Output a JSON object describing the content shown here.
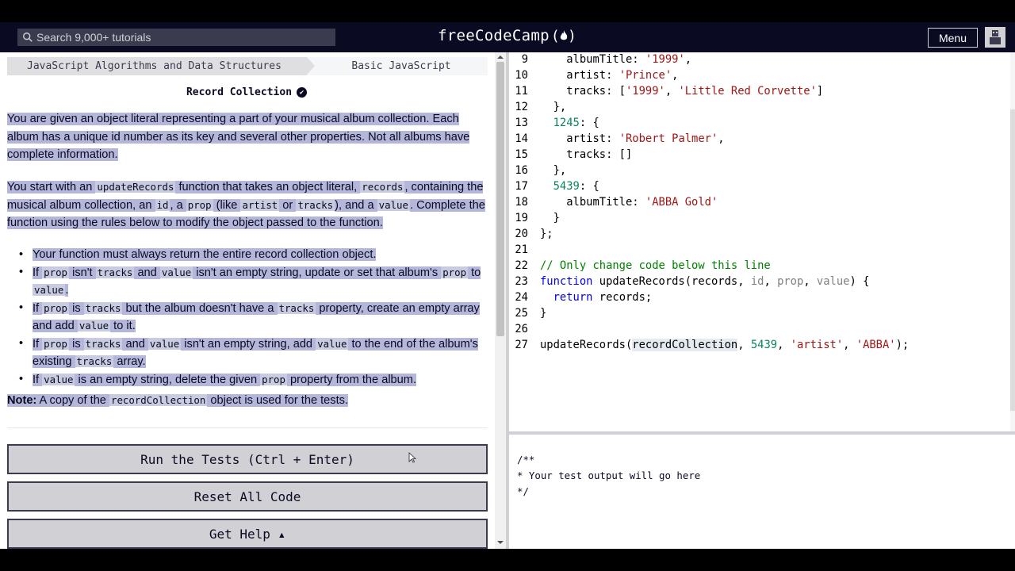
{
  "navbar": {
    "search_placeholder": "Search 9,000+ tutorials",
    "brand": "freeCodeCamp",
    "brand_icon": "(🔥)",
    "menu_label": "Menu"
  },
  "breadcrumb": {
    "superblock": "JavaScript Algorithms and Data Structures",
    "block": "Basic JavaScript"
  },
  "challenge": {
    "title": "Record Collection",
    "check_glyph": "✔"
  },
  "description": {
    "p1": "You are given an object literal representing a part of your musical album collection. Each album has a unique id number as its key and several other properties. Not all albums have complete information.",
    "p2": [
      "You start with an ",
      "updateRecords",
      " function that takes an object literal, ",
      "records",
      ", containing the musical album collection, an ",
      "id",
      ", a ",
      "prop",
      " (like ",
      "artist",
      " or ",
      "tracks",
      "), and a ",
      "value",
      ". Complete the function using the rules below to modify the object passed to the function."
    ],
    "rules": [
      [
        "Your function must always return the entire record collection object."
      ],
      [
        "If ",
        "prop",
        " isn't ",
        "tracks",
        " and ",
        "value",
        " isn't an empty string, update or set that album's ",
        "prop",
        " to ",
        "value",
        "."
      ],
      [
        "If ",
        "prop",
        " is ",
        "tracks",
        " but the album doesn't have a ",
        "tracks",
        " property, create an empty array and add ",
        "value",
        " to it."
      ],
      [
        "If ",
        "prop",
        " is ",
        "tracks",
        " and ",
        "value",
        " isn't an empty string, add ",
        "value",
        " to the end of the album's existing ",
        "tracks",
        " array."
      ],
      [
        "If ",
        "value",
        " is an empty string, delete the given ",
        "prop",
        " property from the album."
      ]
    ],
    "note_label": "Note:",
    "note": [
      " A copy of the ",
      "recordCollection",
      " object is used for the tests."
    ]
  },
  "buttons": {
    "run": "Run the Tests (Ctrl + Enter)",
    "reset": "Reset All Code",
    "help": "Get Help ▴"
  },
  "editor": {
    "lines": [
      {
        "n": "9",
        "t": [
          [
            "    albumTitle: ",
            ""
          ],
          [
            "'1999'",
            "str"
          ],
          [
            ",",
            ""
          ]
        ]
      },
      {
        "n": "10",
        "t": [
          [
            "    artist: ",
            ""
          ],
          [
            "'Prince'",
            "str"
          ],
          [
            ",",
            ""
          ]
        ]
      },
      {
        "n": "11",
        "t": [
          [
            "    tracks: [",
            ""
          ],
          [
            "'1999'",
            "str"
          ],
          [
            ", ",
            ""
          ],
          [
            "'Little Red Corvette'",
            "str"
          ],
          [
            "]",
            ""
          ]
        ]
      },
      {
        "n": "12",
        "t": [
          [
            "  },",
            ""
          ]
        ]
      },
      {
        "n": "13",
        "t": [
          [
            "  ",
            ""
          ],
          [
            "1245",
            "num"
          ],
          [
            ": {",
            ""
          ]
        ]
      },
      {
        "n": "14",
        "t": [
          [
            "    artist: ",
            ""
          ],
          [
            "'Robert Palmer'",
            "str"
          ],
          [
            ",",
            ""
          ]
        ]
      },
      {
        "n": "15",
        "t": [
          [
            "    tracks: []",
            ""
          ]
        ]
      },
      {
        "n": "16",
        "t": [
          [
            "  },",
            ""
          ]
        ]
      },
      {
        "n": "17",
        "t": [
          [
            "  ",
            ""
          ],
          [
            "5439",
            "num"
          ],
          [
            ": {",
            ""
          ]
        ]
      },
      {
        "n": "18",
        "t": [
          [
            "    albumTitle: ",
            ""
          ],
          [
            "'ABBA Gold'",
            "str"
          ]
        ]
      },
      {
        "n": "19",
        "t": [
          [
            "  }",
            ""
          ]
        ]
      },
      {
        "n": "20",
        "t": [
          [
            "};",
            ""
          ]
        ]
      },
      {
        "n": "21",
        "t": [
          [
            "",
            ""
          ]
        ]
      },
      {
        "n": "22",
        "t": [
          [
            "// Only change code below this line",
            "com"
          ]
        ]
      },
      {
        "n": "23",
        "t": [
          [
            "function",
            "kw"
          ],
          [
            " updateRecords(records, ",
            ""
          ],
          [
            "id",
            "param"
          ],
          [
            ", ",
            ""
          ],
          [
            "prop",
            "param"
          ],
          [
            ", ",
            ""
          ],
          [
            "value",
            "param"
          ],
          [
            ") {",
            ""
          ]
        ]
      },
      {
        "n": "24",
        "t": [
          [
            "  ",
            ""
          ],
          [
            "return",
            "kw"
          ],
          [
            " records;",
            ""
          ]
        ]
      },
      {
        "n": "25",
        "t": [
          [
            "}",
            ""
          ]
        ]
      },
      {
        "n": "26",
        "t": [
          [
            "",
            ""
          ]
        ]
      },
      {
        "n": "27",
        "t": [
          [
            "updateRecords(",
            ""
          ],
          [
            "recordCollection",
            "sel"
          ],
          [
            ", ",
            ""
          ],
          [
            "5439",
            "num"
          ],
          [
            ", ",
            ""
          ],
          [
            "'artist'",
            "str"
          ],
          [
            ", ",
            ""
          ],
          [
            "'ABBA'",
            "str"
          ],
          [
            ");",
            ""
          ]
        ]
      }
    ]
  },
  "output": {
    "text": "/**\n* Your test output will go here\n*/"
  },
  "colors": {
    "navbar_bg": "#0a0a23",
    "selection": "#b4b7d9",
    "button_bg": "#d0d0d5"
  }
}
